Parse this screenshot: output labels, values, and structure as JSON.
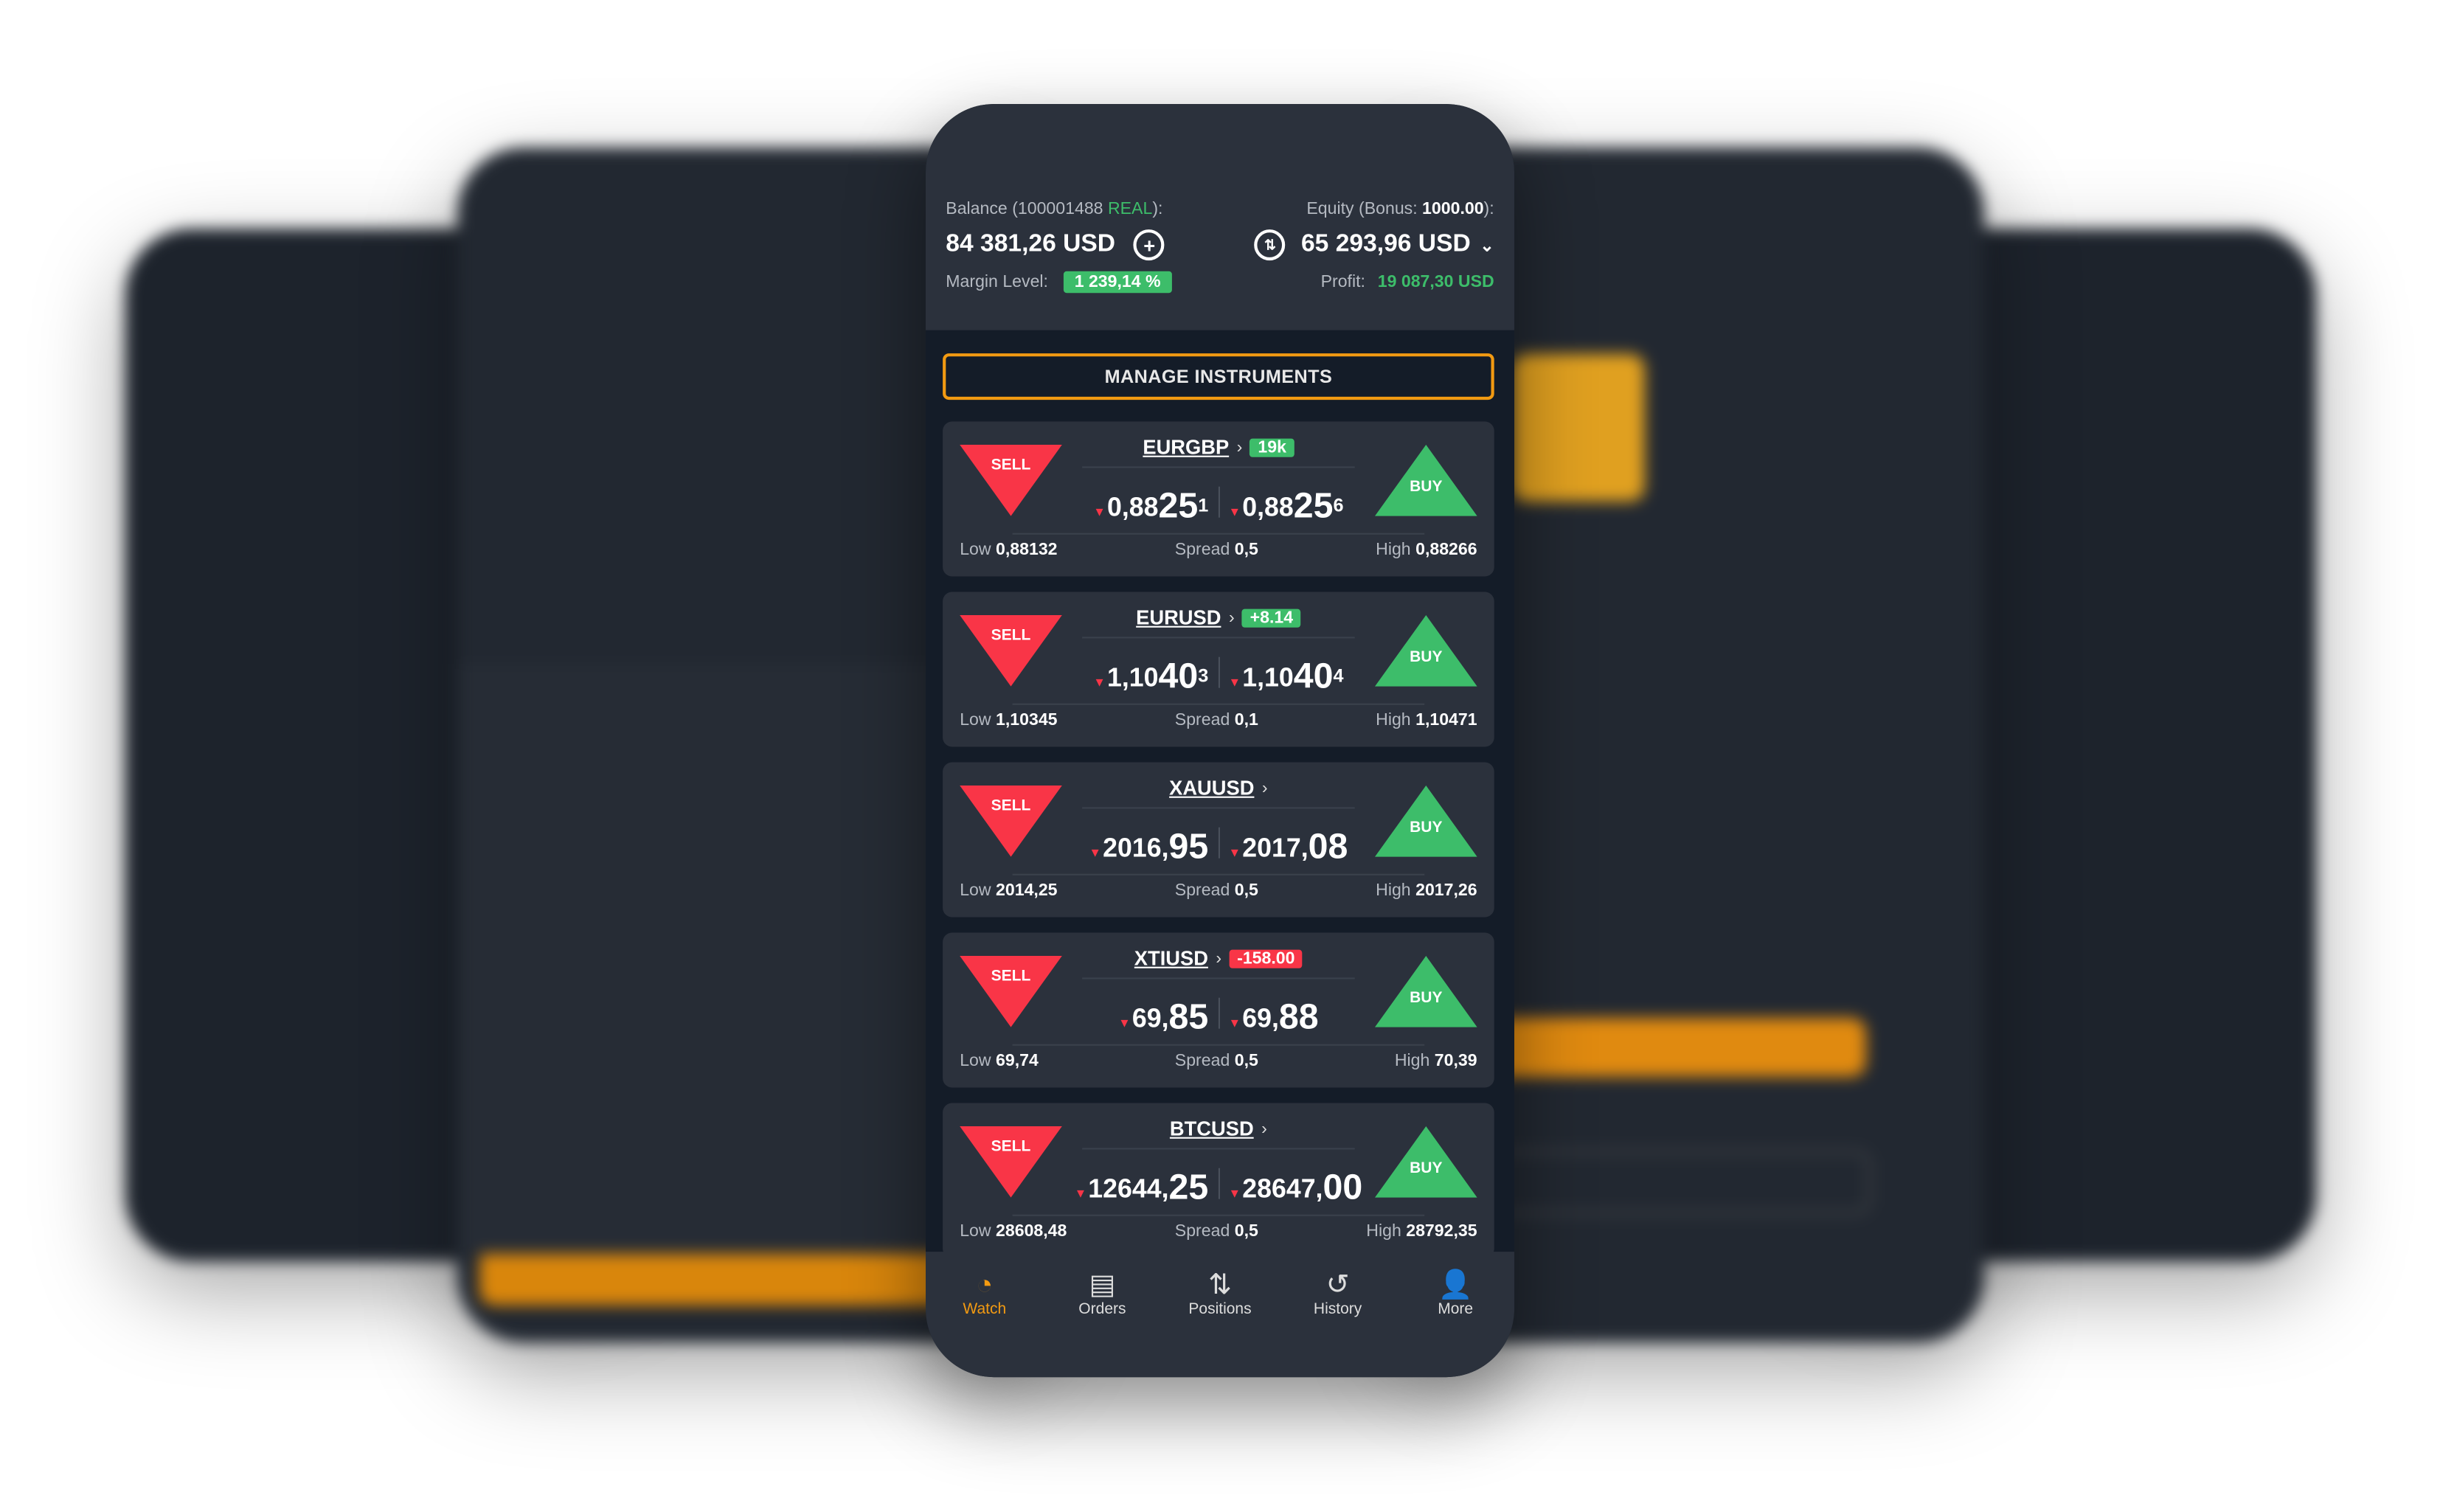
{
  "colors": {
    "accent": "#f29a12",
    "sell": "#f93547",
    "buy": "#3dbd6a",
    "panel": "#2b313c",
    "background": "#141c28"
  },
  "account": {
    "balance_label_prefix": "Balance (100001488 ",
    "account_type": "REAL",
    "balance_label_suffix": "):",
    "balance": "84 381,26 USD",
    "equity_label": "Equity (Bonus: ",
    "bonus": "1000.00",
    "equity_label_suffix": "):",
    "equity": "65 293,96 USD",
    "margin_label": "Margin Level:",
    "margin_level": "1 239,14 %",
    "profit_label": "Profit:",
    "profit": "19 087,30 USD"
  },
  "manage_button": "MANAGE INSTRUMENTS",
  "labels": {
    "sell": "SELL",
    "buy": "BUY",
    "low": "Low",
    "spread": "Spread",
    "high": "High"
  },
  "instruments": [
    {
      "symbol": "EURGBP",
      "change": "19k",
      "change_dir": "up",
      "sell": [
        "0,88",
        "25",
        "1"
      ],
      "buy": [
        "0,88",
        "25",
        "6"
      ],
      "low": "0,88132",
      "spread": "0,5",
      "high": "0,88266"
    },
    {
      "symbol": "EURUSD",
      "change": "+8.14",
      "change_dir": "up",
      "sell": [
        "1,10",
        "40",
        "3"
      ],
      "buy": [
        "1,10",
        "40",
        "4"
      ],
      "low": "1,10345",
      "spread": "0,1",
      "high": "1,10471"
    },
    {
      "symbol": "XAUUSD",
      "change": "",
      "change_dir": "",
      "sell": [
        "2016,",
        "95",
        ""
      ],
      "buy": [
        "2017,",
        "08",
        ""
      ],
      "low": "2014,25",
      "spread": "0,5",
      "high": "2017,26"
    },
    {
      "symbol": "XTIUSD",
      "change": "-158.00",
      "change_dir": "down",
      "sell": [
        "69,",
        "85",
        ""
      ],
      "buy": [
        "69,",
        "88",
        ""
      ],
      "low": "69,74",
      "spread": "0,5",
      "high": "70,39"
    },
    {
      "symbol": "BTCUSD",
      "change": "",
      "change_dir": "",
      "sell": [
        "12644,",
        "25",
        ""
      ],
      "buy": [
        "28647,",
        "00",
        ""
      ],
      "low": "28608,48",
      "spread": "0,5",
      "high": "28792,35"
    }
  ],
  "nav": [
    {
      "label": "Watch",
      "icon": "watch-icon",
      "active": true
    },
    {
      "label": "Orders",
      "icon": "orders-icon"
    },
    {
      "label": "Positions",
      "icon": "positions-icon"
    },
    {
      "label": "History",
      "icon": "history-icon"
    },
    {
      "label": "More",
      "icon": "user-icon"
    }
  ]
}
